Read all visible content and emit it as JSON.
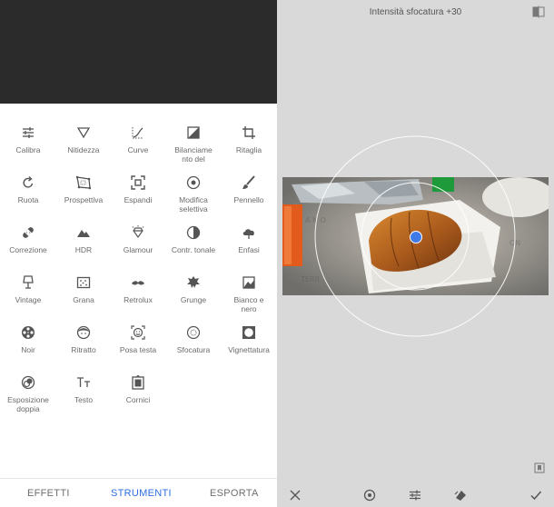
{
  "tools": [
    {
      "label": "Calibra",
      "icon": "sliders-icon"
    },
    {
      "label": "Nitidezza",
      "icon": "triangle-down-icon"
    },
    {
      "label": "Curve",
      "icon": "curve-icon"
    },
    {
      "label": "Bilanciame\nnto del",
      "icon": "white-balance-icon"
    },
    {
      "label": "Ritaglia",
      "icon": "crop-icon"
    },
    {
      "label": "Ruota",
      "icon": "rotate-icon"
    },
    {
      "label": "Prospettiva",
      "icon": "perspective-icon"
    },
    {
      "label": "Espandi",
      "icon": "expand-icon"
    },
    {
      "label": "Modifica\nselettiva",
      "icon": "selective-icon"
    },
    {
      "label": "Pennello",
      "icon": "brush-icon"
    },
    {
      "label": "Correzione",
      "icon": "bandage-icon"
    },
    {
      "label": "HDR",
      "icon": "mountains-icon"
    },
    {
      "label": "Glamour",
      "icon": "diamond-icon"
    },
    {
      "label": "Contr. tonale",
      "icon": "tonal-contrast-icon"
    },
    {
      "label": "Enfasi",
      "icon": "cloud-icon"
    },
    {
      "label": "Vintage",
      "icon": "lamp-icon"
    },
    {
      "label": "Grana",
      "icon": "grain-icon"
    },
    {
      "label": "Retrolux",
      "icon": "mustache-icon"
    },
    {
      "label": "Grunge",
      "icon": "grunge-icon"
    },
    {
      "label": "Bianco e\nnero",
      "icon": "black-white-icon"
    },
    {
      "label": "Noir",
      "icon": "film-reel-icon"
    },
    {
      "label": "Ritratto",
      "icon": "face-icon"
    },
    {
      "label": "Posa testa",
      "icon": "face-frame-icon"
    },
    {
      "label": "Sfocatura",
      "icon": "lens-blur-icon"
    },
    {
      "label": "Vignettatura",
      "icon": "vignette-icon"
    },
    {
      "label": "Esposizione\ndoppia",
      "icon": "double-exposure-icon"
    },
    {
      "label": "Testo",
      "icon": "text-icon"
    },
    {
      "label": "Cornici",
      "icon": "frame-icon"
    }
  ],
  "nav": {
    "effetti": "EFFETTI",
    "strumenti": "STRUMENTI",
    "esporta": "ESPORTA"
  },
  "editor": {
    "title": "Intensità sfocatura +30"
  },
  "colors": {
    "accent": "#2f6fe0",
    "dark_header": "#2b2b2b",
    "editor_bg": "#d9d9d9"
  }
}
